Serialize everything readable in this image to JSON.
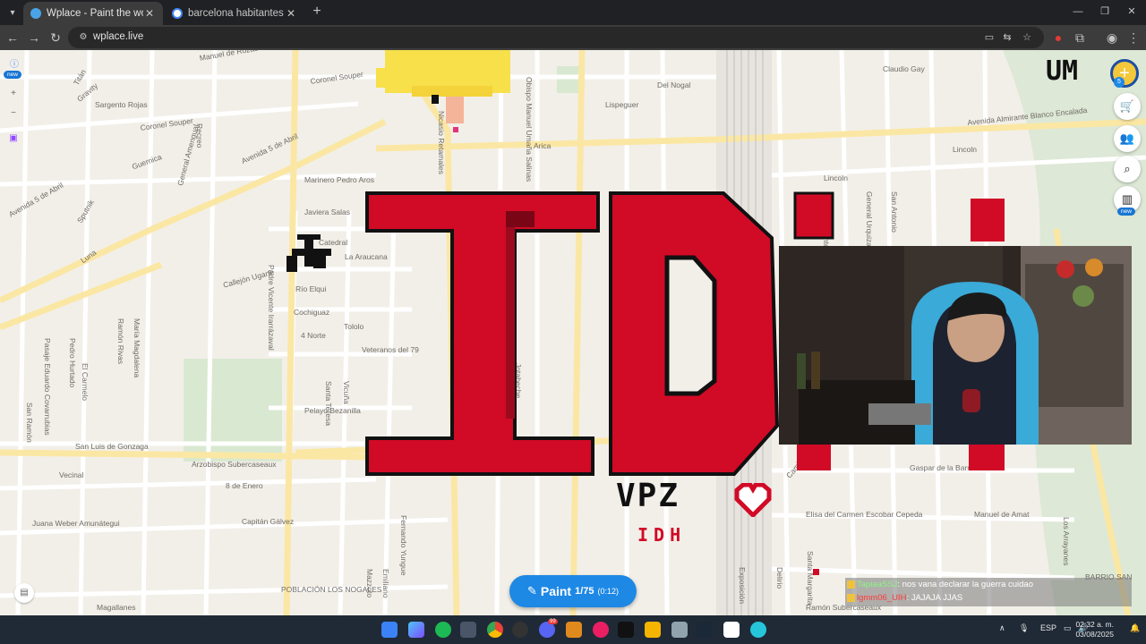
{
  "browser": {
    "tabs": [
      {
        "title": "Wplace - Paint the world",
        "active": true
      },
      {
        "title": "barcelona habitantes - Buscar c",
        "active": false
      }
    ],
    "url": "wplace.live"
  },
  "map": {
    "streets": [
      "Manuel de Rozas",
      "Coronel Souper",
      "Titán",
      "Gravity",
      "Sargento Rojas",
      "Coronel Souper",
      "Recreo",
      "General Amengual",
      "Guernica",
      "Avenida 5 de Abril",
      "Marinero Pedro Aros",
      "Javiera Salas",
      "Catedral",
      "La Araucana",
      "Callejón Ugarte",
      "Río Elqui",
      "Cochiguaz",
      "Tololo",
      "4 Norte",
      "Veteranos del 79",
      "Santa Teresa",
      "Vicuña",
      "Pelayo Bezanilla",
      "San Luis de Gonzaga",
      "Arzobispo Subercaseaux",
      "8 de Enero",
      "Vecinal",
      "Juana Weber Amunátegui",
      "Capitán Gálvez",
      "POBLACIÓN LOS NOGALES",
      "Magallanes",
      "Arica",
      "Del Nogal",
      "Lispeguer",
      "Claudio Gay",
      "Avenida Almirante Blanco Encalada",
      "Lincoln",
      "Lincoln",
      "General Urquiza",
      "San Antonio",
      "Gaspar de la Barrera",
      "Elisa del Carmen Escobar Cepeda",
      "Manuel de Amat",
      "Ramón Subercaseaux",
      "Santa Margarita",
      "Nicasio Retamales",
      "Obispo Manuel Umaña Salinas",
      "San Francisco de Borja",
      "Jotabeche",
      "Ramón Rivas",
      "María Magdalena",
      "Pasaje Eduardo Covarrubias",
      "Pedro Hurtado",
      "El Carmelo",
      "San Ramón",
      "Los Arrayanes",
      "Avenida 5 de Abril",
      "Luna",
      "Sputnik",
      "Padre Vicente Irarrázaval",
      "Camino la Vega",
      "Delirio",
      "Exposición",
      "Fernando Yungue",
      "Mazzoto",
      "Emiliano",
      "San Vicente",
      "BARRIO SAN"
    ]
  },
  "art": {
    "letters": "ID",
    "signature": "VPZ",
    "subtag": "IDH"
  },
  "top_logo": "UM",
  "left_panel": {
    "new_badge": "new"
  },
  "right_panel": {
    "new_badge": "new",
    "notification_count": "5"
  },
  "paint_button": {
    "label": "Paint",
    "count": "1/75",
    "timer": "(0:12)"
  },
  "chat": [
    {
      "user": "TapiaaSSJ",
      "message": ": nos vana declarar la guerra cuidao"
    },
    {
      "user": "lgmm06_UIH",
      "message": ": JAJAJA JJAS"
    }
  ],
  "taskbar": {
    "lang": "ESP",
    "time": "02:32 a. m.",
    "date": "03/08/2025",
    "discord_badge": "99"
  },
  "colors": {
    "accent": "#1e88e5",
    "art_red": "#d10a26",
    "map_bg": "#f2efe9"
  }
}
